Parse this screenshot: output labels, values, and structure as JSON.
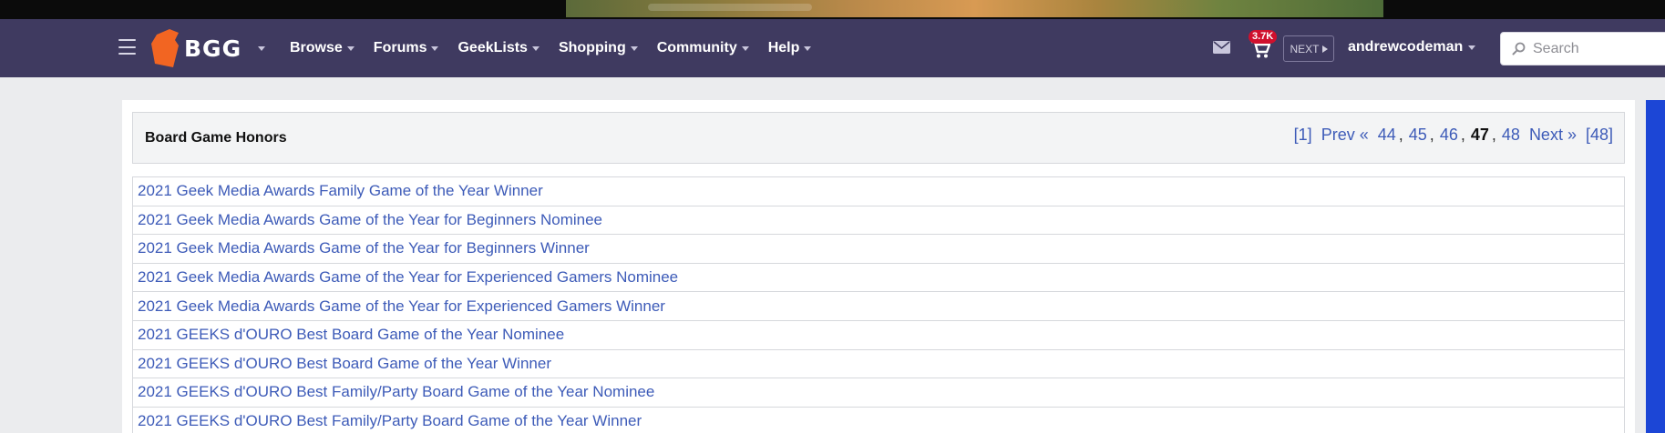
{
  "nav": {
    "logo_text": "BGG",
    "menu": [
      {
        "label": "Browse"
      },
      {
        "label": "Forums"
      },
      {
        "label": "GeekLists"
      },
      {
        "label": "Shopping"
      },
      {
        "label": "Community"
      },
      {
        "label": "Help"
      }
    ],
    "cart_badge": "3.7K",
    "next_label": "NEXT",
    "username": "andrewcodeman",
    "search_placeholder": "Search"
  },
  "page": {
    "title": "Board Game Honors"
  },
  "pager": {
    "first": "[1]",
    "prev": "Prev «",
    "pages": [
      "44",
      "45",
      "46"
    ],
    "current": "47",
    "after": [
      "48"
    ],
    "next": "Next »",
    "last": "[48]",
    "separator": ","
  },
  "honors": [
    "2021 Geek Media Awards Family Game of the Year Winner",
    "2021 Geek Media Awards Game of the Year for Beginners Nominee",
    "2021 Geek Media Awards Game of the Year for Beginners Winner",
    "2021 Geek Media Awards Game of the Year for Experienced Gamers Nominee",
    "2021 Geek Media Awards Game of the Year for Experienced Gamers Winner",
    "2021 GEEKS d'OURO Best Board Game of the Year Nominee",
    "2021 GEEKS d'OURO Best Board Game of the Year Winner",
    "2021 GEEKS d'OURO Best Family/Party Board Game of the Year Nominee",
    "2021 GEEKS d'OURO Best Family/Party Board Game of the Year Winner"
  ],
  "colors": {
    "nav_bg": "#3f3a60",
    "link": "#3d5bb8",
    "logo_orange": "#f26522",
    "badge_red": "#d0102d"
  }
}
